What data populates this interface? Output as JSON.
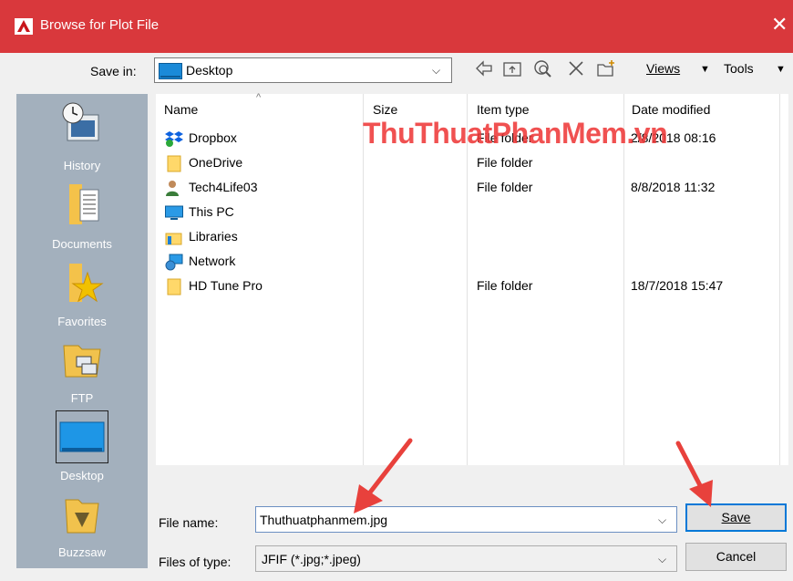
{
  "window": {
    "title": "Browse for Plot File",
    "close_glyph": "✕"
  },
  "toolbar": {
    "save_in_label": "Save in:",
    "location": "Desktop",
    "views_label": "Views",
    "tools_label": "Tools",
    "icons": [
      "back-icon",
      "up-folder-icon",
      "search-web-icon",
      "delete-icon",
      "new-folder-icon"
    ]
  },
  "places": [
    {
      "label": "History",
      "icon": "history-icon"
    },
    {
      "label": "Documents",
      "icon": "documents-icon"
    },
    {
      "label": "Favorites",
      "icon": "favorites-icon"
    },
    {
      "label": "FTP",
      "icon": "ftp-icon"
    },
    {
      "label": "Desktop",
      "icon": "desktop-icon",
      "selected": true
    },
    {
      "label": "Buzzsaw",
      "icon": "buzzsaw-icon"
    }
  ],
  "columns": {
    "name": "Name",
    "size": "Size",
    "type": "Item type",
    "date": "Date modified"
  },
  "files": [
    {
      "name": "Dropbox",
      "type": "File folder",
      "date": "2/8/2018 08:16",
      "icon": "dropbox-icon"
    },
    {
      "name": "OneDrive",
      "type": "File folder",
      "date": "",
      "icon": "folder-icon"
    },
    {
      "name": "Tech4Life03",
      "type": "File folder",
      "date": "8/8/2018 11:32",
      "icon": "user-folder-icon"
    },
    {
      "name": "This PC",
      "type": "",
      "date": "",
      "icon": "pc-icon"
    },
    {
      "name": "Libraries",
      "type": "",
      "date": "",
      "icon": "libraries-icon"
    },
    {
      "name": "Network",
      "type": "",
      "date": "",
      "icon": "network-icon"
    },
    {
      "name": "HD Tune Pro",
      "type": "File folder",
      "date": "18/7/2018 15:47",
      "icon": "folder-icon"
    }
  ],
  "watermark": "ThuThuatPhanMem.vn",
  "form": {
    "file_name_label": "File name:",
    "file_name_value": "Thuthuatphanmem.jpg",
    "file_type_label": "Files of type:",
    "file_type_value": "JFIF (*.jpg;*.jpeg)",
    "save_button": "Save",
    "cancel_button": "Cancel"
  },
  "colors": {
    "titlebar": "#d9383c",
    "places_bg": "#a3b0bd",
    "arrow": "#e8413c"
  }
}
